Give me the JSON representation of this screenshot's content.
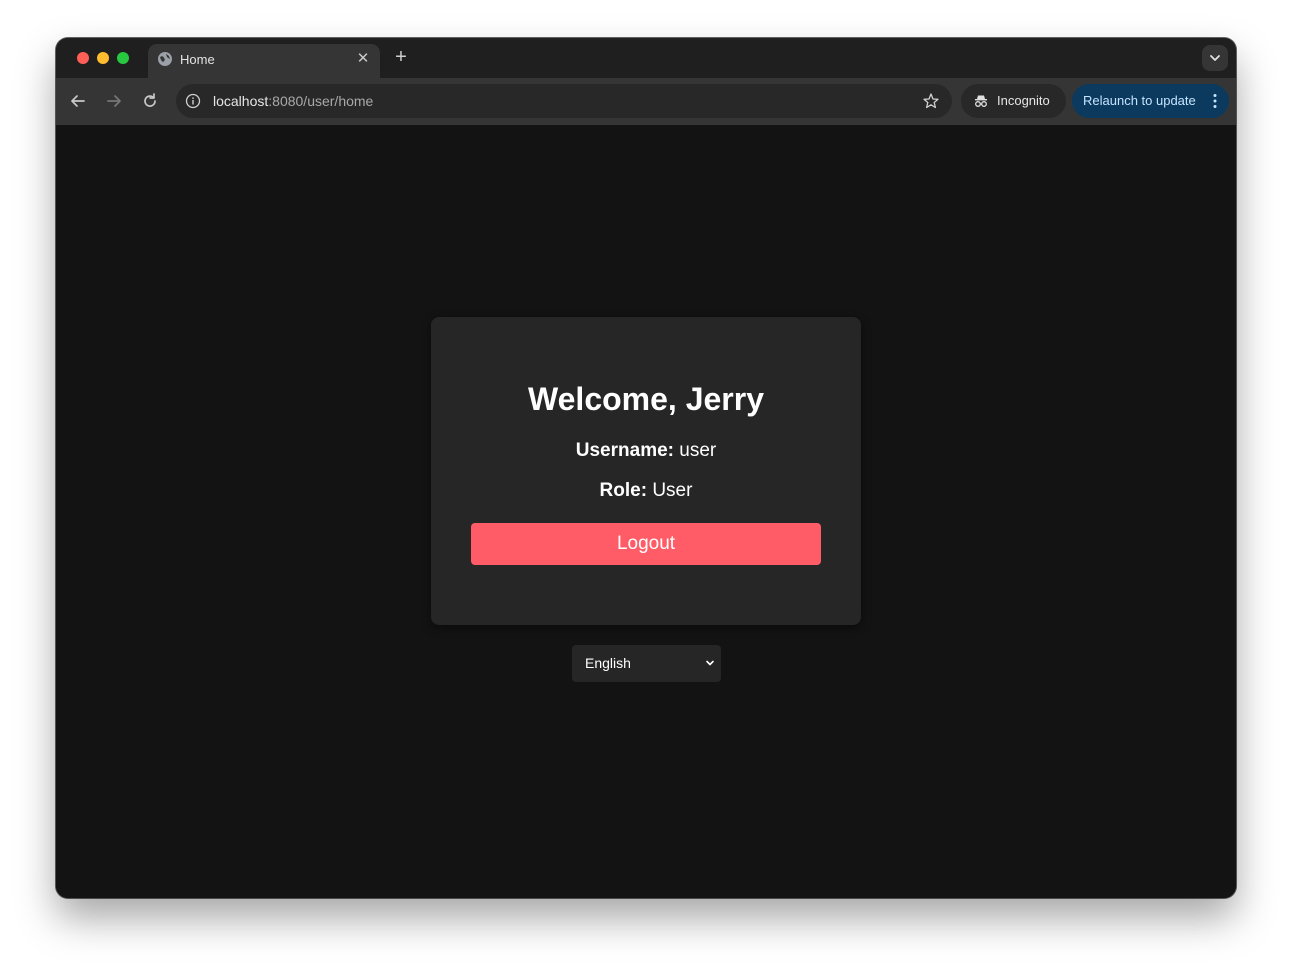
{
  "browser": {
    "tab": {
      "title": "Home",
      "close_glyph": "✕"
    },
    "new_tab_glyph": "+",
    "address_bar": {
      "host": "localhost",
      "rest": ":8080/user/home"
    },
    "incognito_label": "Incognito",
    "relaunch_label": "Relaunch to update",
    "colors": {
      "relaunch_bg": "#0b3a5e",
      "tab_bg": "#353535",
      "page_bg": "#131313"
    }
  },
  "card": {
    "welcome": "Welcome, Jerry",
    "username_label": "Username:",
    "username_value": "user",
    "role_label": "Role:",
    "role_value": "User",
    "logout_label": "Logout",
    "colors": {
      "logout_bg": "#ff5c67",
      "card_bg": "#262626"
    }
  },
  "language_select": {
    "selected": "English"
  },
  "icons": [
    "globe-icon",
    "close-icon",
    "plus-icon",
    "chevron-down-icon",
    "back-arrow-icon",
    "forward-arrow-icon",
    "reload-icon",
    "info-icon",
    "star-icon",
    "incognito-icon",
    "kebab-menu-icon"
  ]
}
